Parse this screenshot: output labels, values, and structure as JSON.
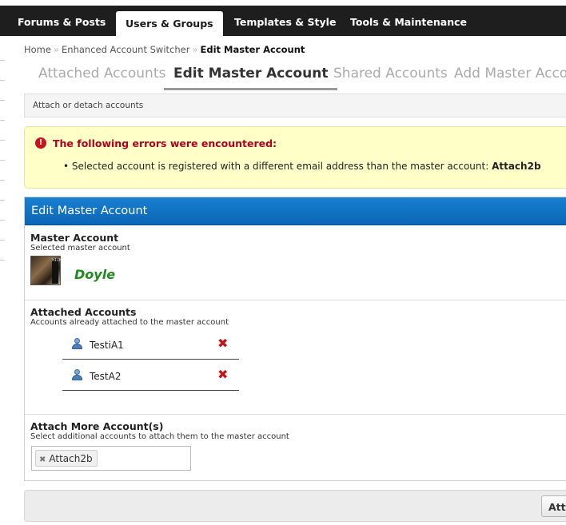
{
  "nav": {
    "tabs": [
      {
        "label": "Forums & Posts"
      },
      {
        "label": "Users & Groups"
      },
      {
        "label": "Templates & Style"
      },
      {
        "label": "Tools & Maintenance"
      }
    ],
    "active": "Users & Groups"
  },
  "breadcrumb": {
    "items": [
      "Home",
      "Enhanced Account Switcher"
    ],
    "current": "Edit Master Account",
    "separator": "»"
  },
  "page_tabs": {
    "items": [
      {
        "label": "Attached Accounts"
      },
      {
        "label": "Edit Master Account"
      },
      {
        "label": "Shared Accounts"
      },
      {
        "label": "Add Master Account"
      }
    ],
    "active": "Edit Master Account"
  },
  "subbar": {
    "text": "Attach or detach accounts"
  },
  "errors": {
    "heading": "The following errors were encountered:",
    "message": "Selected account is registered with a different email address than the master account:",
    "account": "Attach2b"
  },
  "form": {
    "title": "Edit Master Account",
    "master": {
      "label": "Master Account",
      "description": "Selected master account",
      "username": "Doyle",
      "avatar_text": "MICK"
    },
    "attached": {
      "label": "Attached Accounts",
      "description": "Accounts already attached to the master account",
      "accounts": [
        "TestiA1",
        "TestA2"
      ]
    },
    "attach_more": {
      "label": "Attach More Account(s)",
      "description": "Select additional accounts to attach them to the master account",
      "tokens": [
        "Attach2b"
      ]
    }
  },
  "footer": {
    "button_label": "Attach"
  },
  "colors": {
    "header_bar": "#1e1e1e",
    "panel_header": "#1171c4",
    "error_bg": "#ffffc8",
    "error_text": "#b3001b",
    "username": "#1f8a1f",
    "delete_icon": "#c0171d"
  }
}
